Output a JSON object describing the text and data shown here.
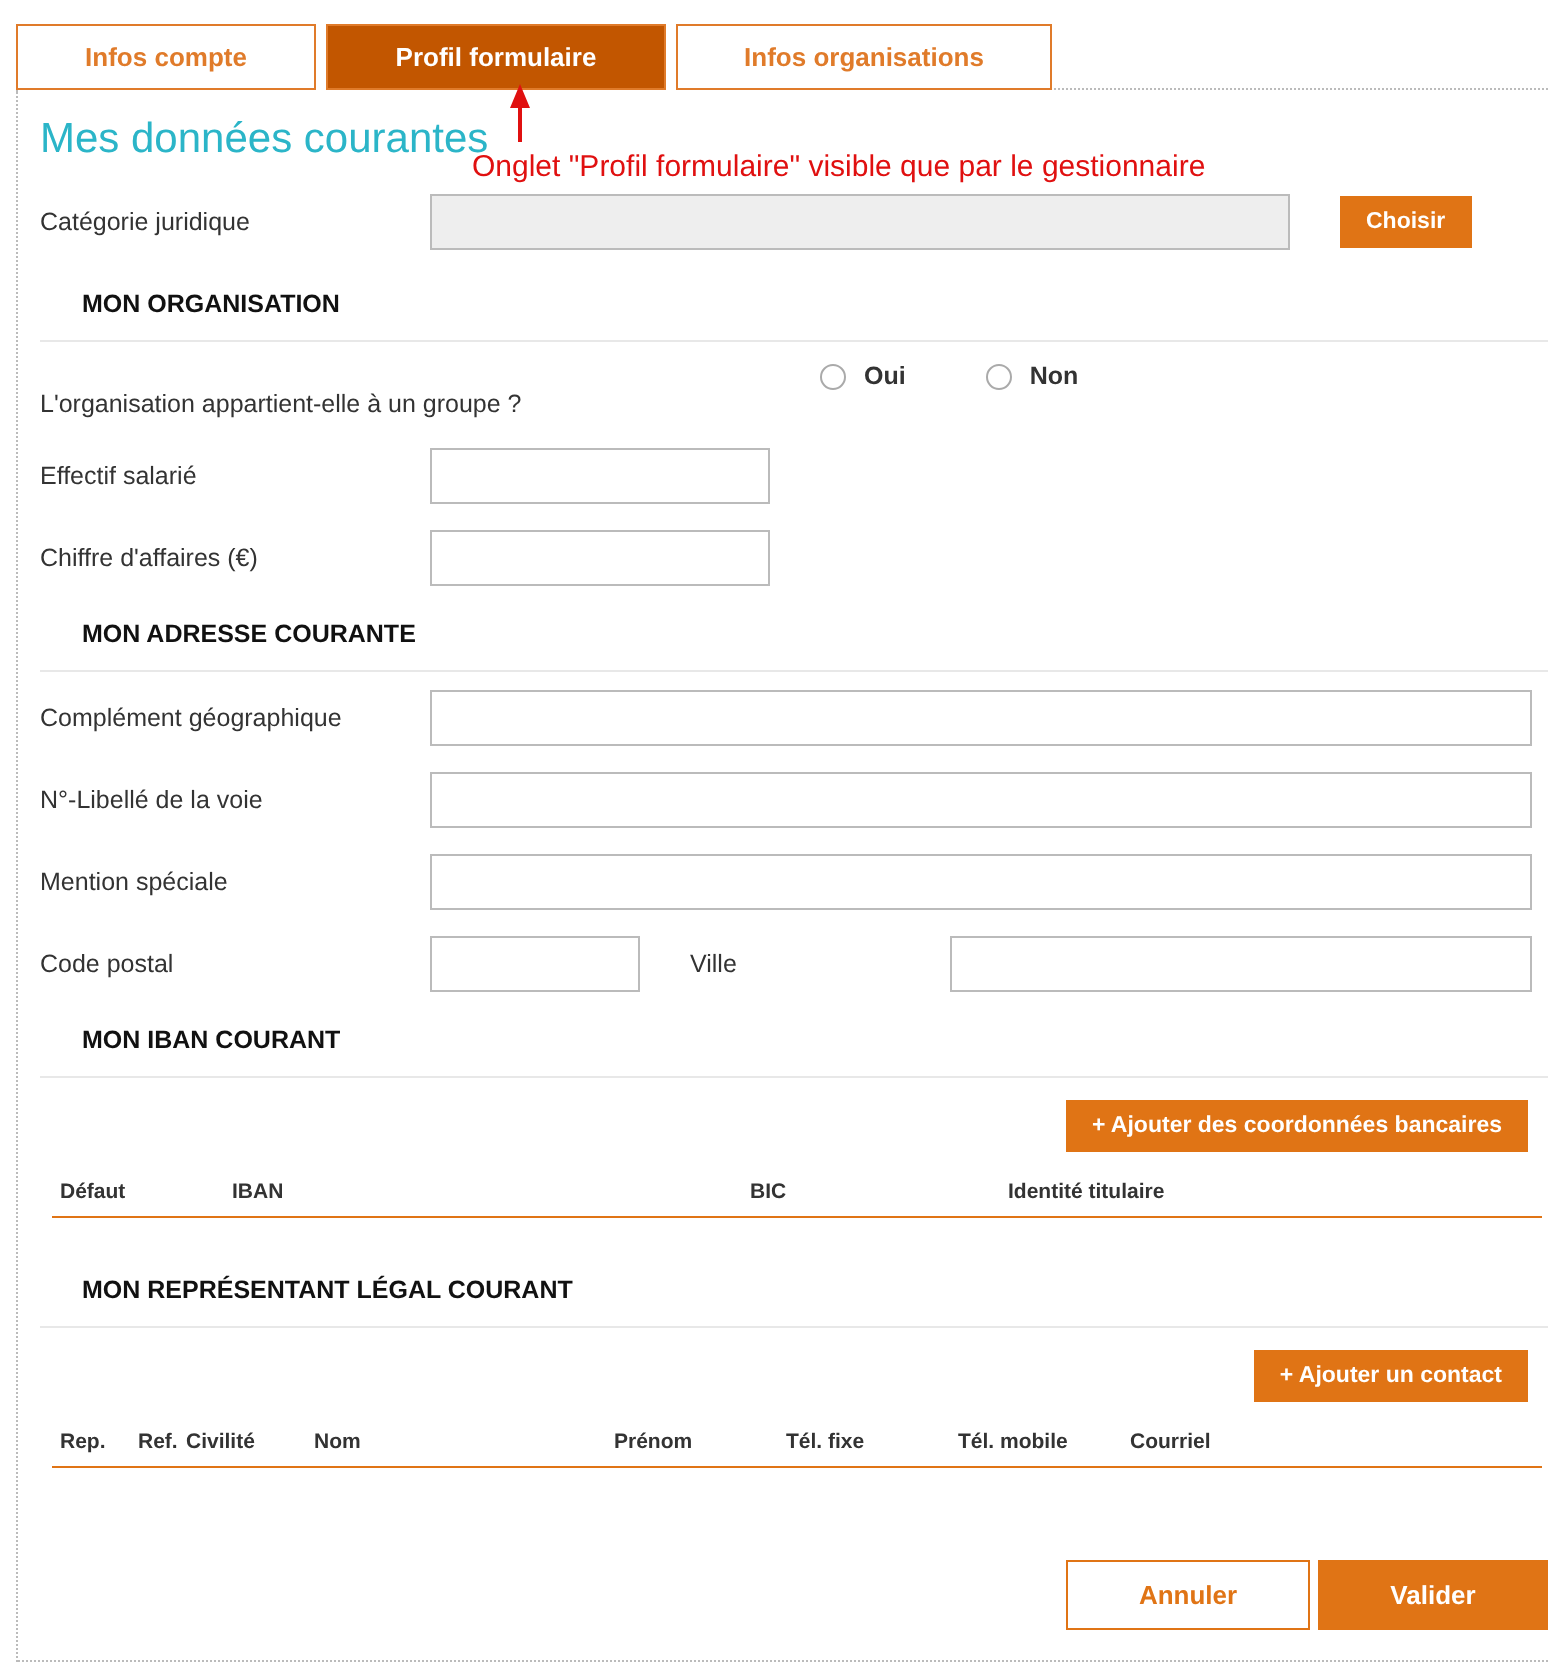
{
  "tabs": [
    {
      "label": "Infos compte",
      "selected": false
    },
    {
      "label": "Profil formulaire",
      "selected": true
    },
    {
      "label": "Infos organisations",
      "selected": false
    }
  ],
  "annotation": {
    "text": "Onglet \"Profil formulaire\" visible que par le gestionnaire"
  },
  "title": "Mes données courantes",
  "legal_category": {
    "label": "Catégorie juridique",
    "button": "Choisir"
  },
  "sections": [
    {
      "heading": "MON ORGANISATION",
      "rows": [
        {
          "kind": "radio",
          "label": "L'organisation appartient-elle à un groupe ?",
          "options": [
            {
              "label": "Oui",
              "selected": false
            },
            {
              "label": "Non",
              "selected": false
            }
          ]
        },
        {
          "kind": "short",
          "label": "Effectif salarié"
        },
        {
          "kind": "short",
          "label": "Chiffre d'affaires (€)"
        }
      ]
    },
    {
      "heading": "MON ADRESSE COURANTE",
      "rows": [
        {
          "kind": "wide",
          "label": "Complément géographique"
        },
        {
          "kind": "wide",
          "label": "N°-Libellé de la voie"
        },
        {
          "kind": "wide",
          "label": "Mention spéciale"
        },
        {
          "kind": "pair",
          "label": "Code postal",
          "label_2": "Ville"
        }
      ]
    },
    {
      "heading": "MON IBAN COURANT",
      "button": "+ Ajouter des coordonnées bancaires",
      "columns": [
        "Défaut",
        "IBAN",
        "BIC",
        "Identité titulaire"
      ]
    },
    {
      "heading": "MON REPRÉSENTANT LÉGAL COURANT",
      "button": "+ Ajouter un contact",
      "columns": [
        "Rep.",
        "Ref.",
        "Civilité",
        "Nom",
        "Prénom",
        "Tél. fixe",
        "Tél. mobile",
        "Courriel"
      ]
    }
  ],
  "actions": [
    {
      "label": "Annuler",
      "kind": "secondary"
    },
    {
      "label": "Valider",
      "kind": "primary"
    }
  ]
}
